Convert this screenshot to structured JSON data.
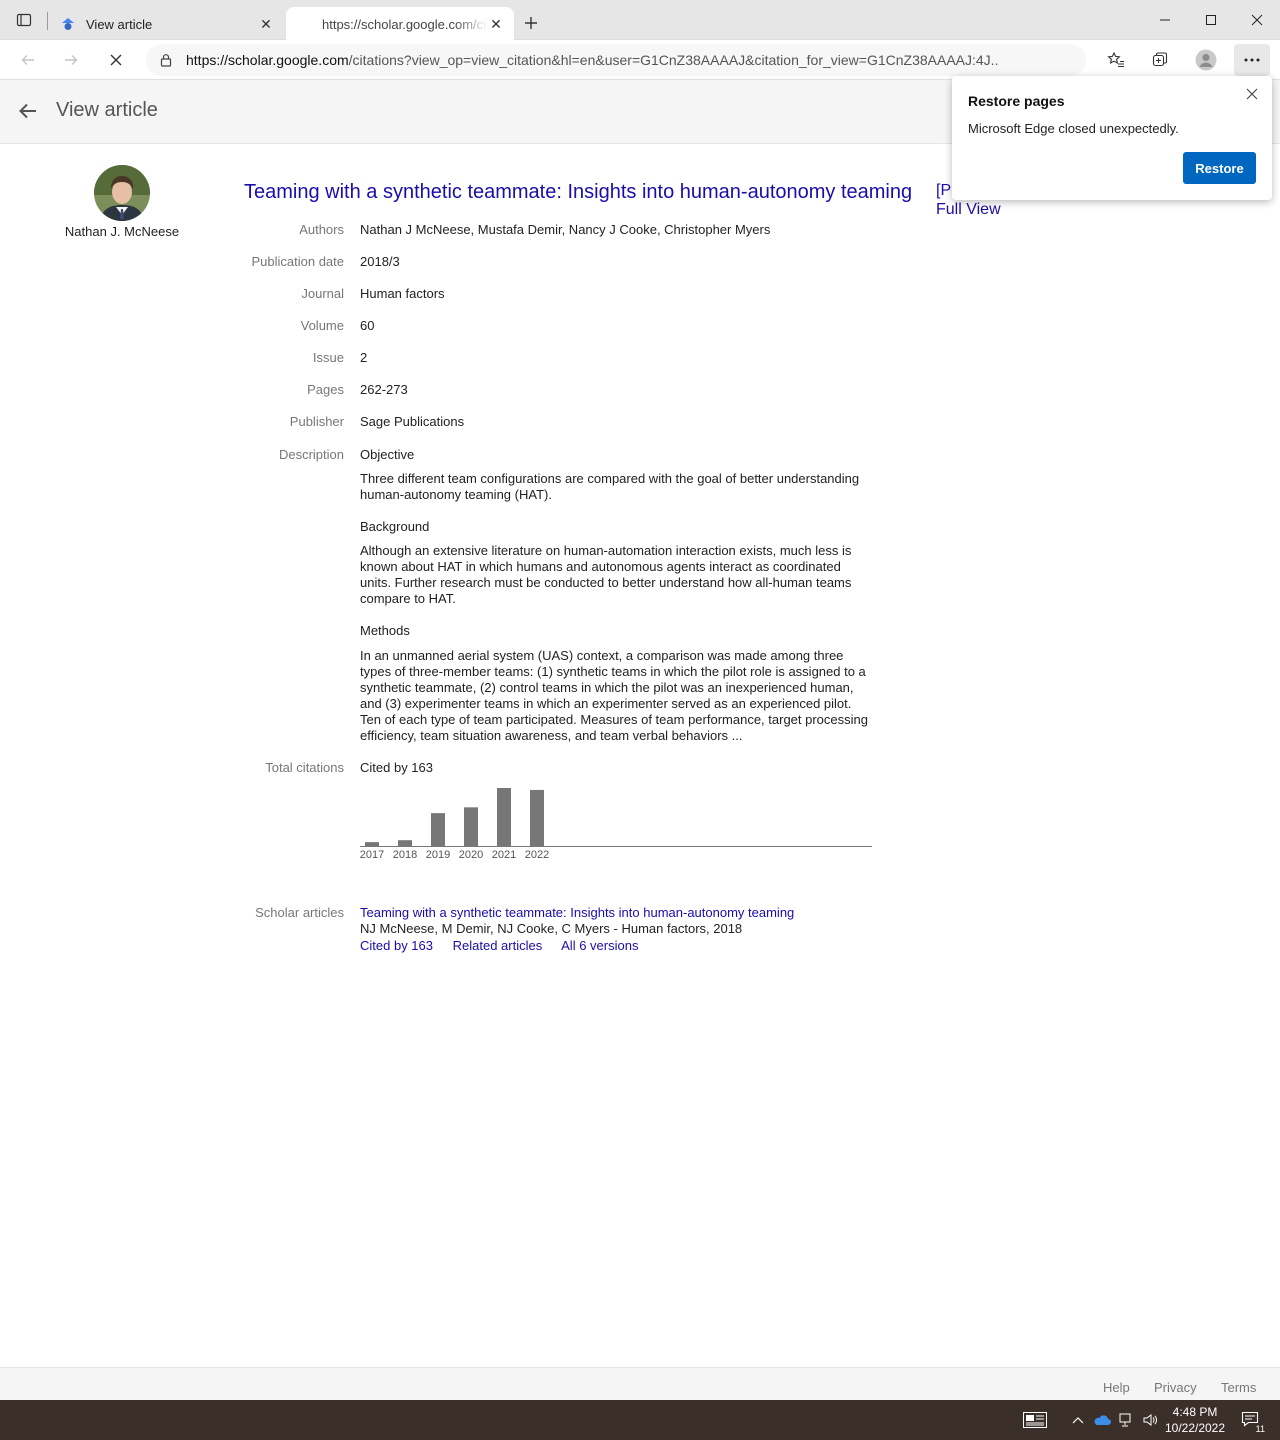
{
  "browser": {
    "tabs": [
      {
        "title": "View article",
        "active": false
      },
      {
        "title": "https://scholar.google.com/citations",
        "active": true
      }
    ],
    "url_host": "https://scholar.google.com",
    "url_path": "/citations?view_op=view_citation&hl=en&user=G1CnZ38AAAAJ&citation_for_view=G1CnZ38AAAAJ:4J..."
  },
  "header": {
    "title": "View article"
  },
  "author": {
    "name": "Nathan J. McNeese"
  },
  "article": {
    "title": "Teaming with a synthetic teammate: Insights into human-autonomy teaming",
    "pdf_link_prefix": "[P",
    "full_view": "Full View",
    "fields": {
      "authors_label": "Authors",
      "authors": "Nathan J McNeese, Mustafa Demir, Nancy J Cooke, Christopher Myers",
      "date_label": "Publication date",
      "date": "2018/3",
      "journal_label": "Journal",
      "journal": "Human factors",
      "volume_label": "Volume",
      "volume": "60",
      "issue_label": "Issue",
      "issue": "2",
      "pages_label": "Pages",
      "pages": "262-273",
      "publisher_label": "Publisher",
      "publisher": "Sage Publications",
      "description_label": "Description"
    },
    "description": {
      "objective_head": "Objective",
      "objective": "Three different team configurations are compared with the goal of better understanding human-autonomy teaming (HAT).",
      "background_head": "Background",
      "background": "Although an extensive literature on human-automation interaction exists, much less is known about HAT in which humans and autonomous agents interact as coordinated units. Further research must be conducted to better understand how all-human teams compare to HAT.",
      "methods_head": "Methods",
      "methods": "In an unmanned aerial system (UAS) context, a comparison was made among three types of three-member teams: (1) synthetic teams in which the pilot role is assigned to a synthetic teammate, (2) control teams in which the pilot was an inexperienced human, and (3) experimenter teams in which an experimenter served as an experienced pilot. Ten of each type of team participated. Measures of team performance, target processing efficiency, team situation awareness, and team verbal behaviors ..."
    },
    "citations": {
      "label": "Total citations",
      "cited_by": "Cited by 163"
    },
    "scholar_articles": {
      "label": "Scholar articles",
      "title": "Teaming with a synthetic teammate: Insights into human-autonomy teaming",
      "meta": "NJ McNeese, M Demir, NJ Cooke, C Myers - Human factors, 2018",
      "cited_by": "Cited by 163",
      "related": "Related articles",
      "versions": "All 6 versions"
    }
  },
  "chart_data": {
    "type": "bar",
    "categories": [
      "2017",
      "2018",
      "2019",
      "2020",
      "2021",
      "2022"
    ],
    "values": [
      2,
      3,
      17,
      20,
      30,
      29
    ],
    "ylim": [
      0,
      30
    ],
    "bar_color": "#777777"
  },
  "popup": {
    "title": "Restore pages",
    "message": "Microsoft Edge closed unexpectedly.",
    "button": "Restore"
  },
  "footer": {
    "help": "Help",
    "privacy": "Privacy",
    "terms": "Terms"
  },
  "taskbar": {
    "time": "4:48 PM",
    "date": "10/22/2022",
    "notification_count": "11"
  },
  "colors": {
    "link": "#1a0dab",
    "accent": "#0067c0",
    "taskbar": "#3b2f2a"
  }
}
